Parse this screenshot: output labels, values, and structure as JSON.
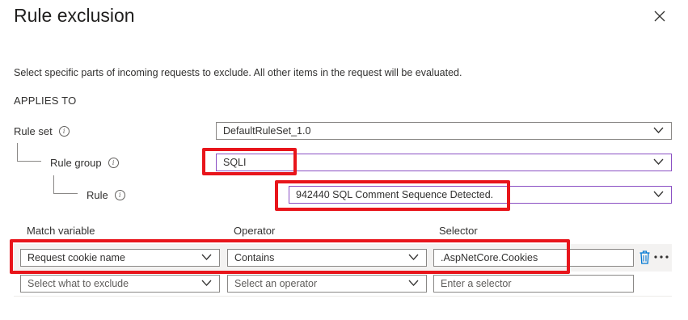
{
  "panel": {
    "title": "Rule exclusion",
    "description": "Select specific parts of incoming requests to exclude. All other items in the request will be evaluated.",
    "section_heading": "APPLIES TO"
  },
  "applies_to": {
    "rule_set": {
      "label": "Rule set",
      "value": "DefaultRuleSet_1.0"
    },
    "rule_group": {
      "label": "Rule group",
      "value": "SQLI"
    },
    "rule": {
      "label": "Rule",
      "value": "942440 SQL Comment Sequence Detected."
    }
  },
  "table": {
    "headers": [
      "Match variable",
      "Operator",
      "Selector"
    ],
    "rows": [
      {
        "match_variable": "Request cookie name",
        "operator": "Contains",
        "selector": ".AspNetCore.Cookies"
      }
    ],
    "new_row": {
      "match_variable_placeholder": "Select what to exclude",
      "operator_placeholder": "Select an operator",
      "selector_placeholder": "Enter a selector"
    }
  },
  "icons": {
    "close": "close-icon",
    "info": "info-icon",
    "chevron": "chevron-down-icon",
    "delete": "trash-icon",
    "more": "more-icon"
  },
  "colors": {
    "highlight": "#e8151b",
    "purple_border": "#8a4fc3",
    "delete_icon": "#0078d4"
  }
}
